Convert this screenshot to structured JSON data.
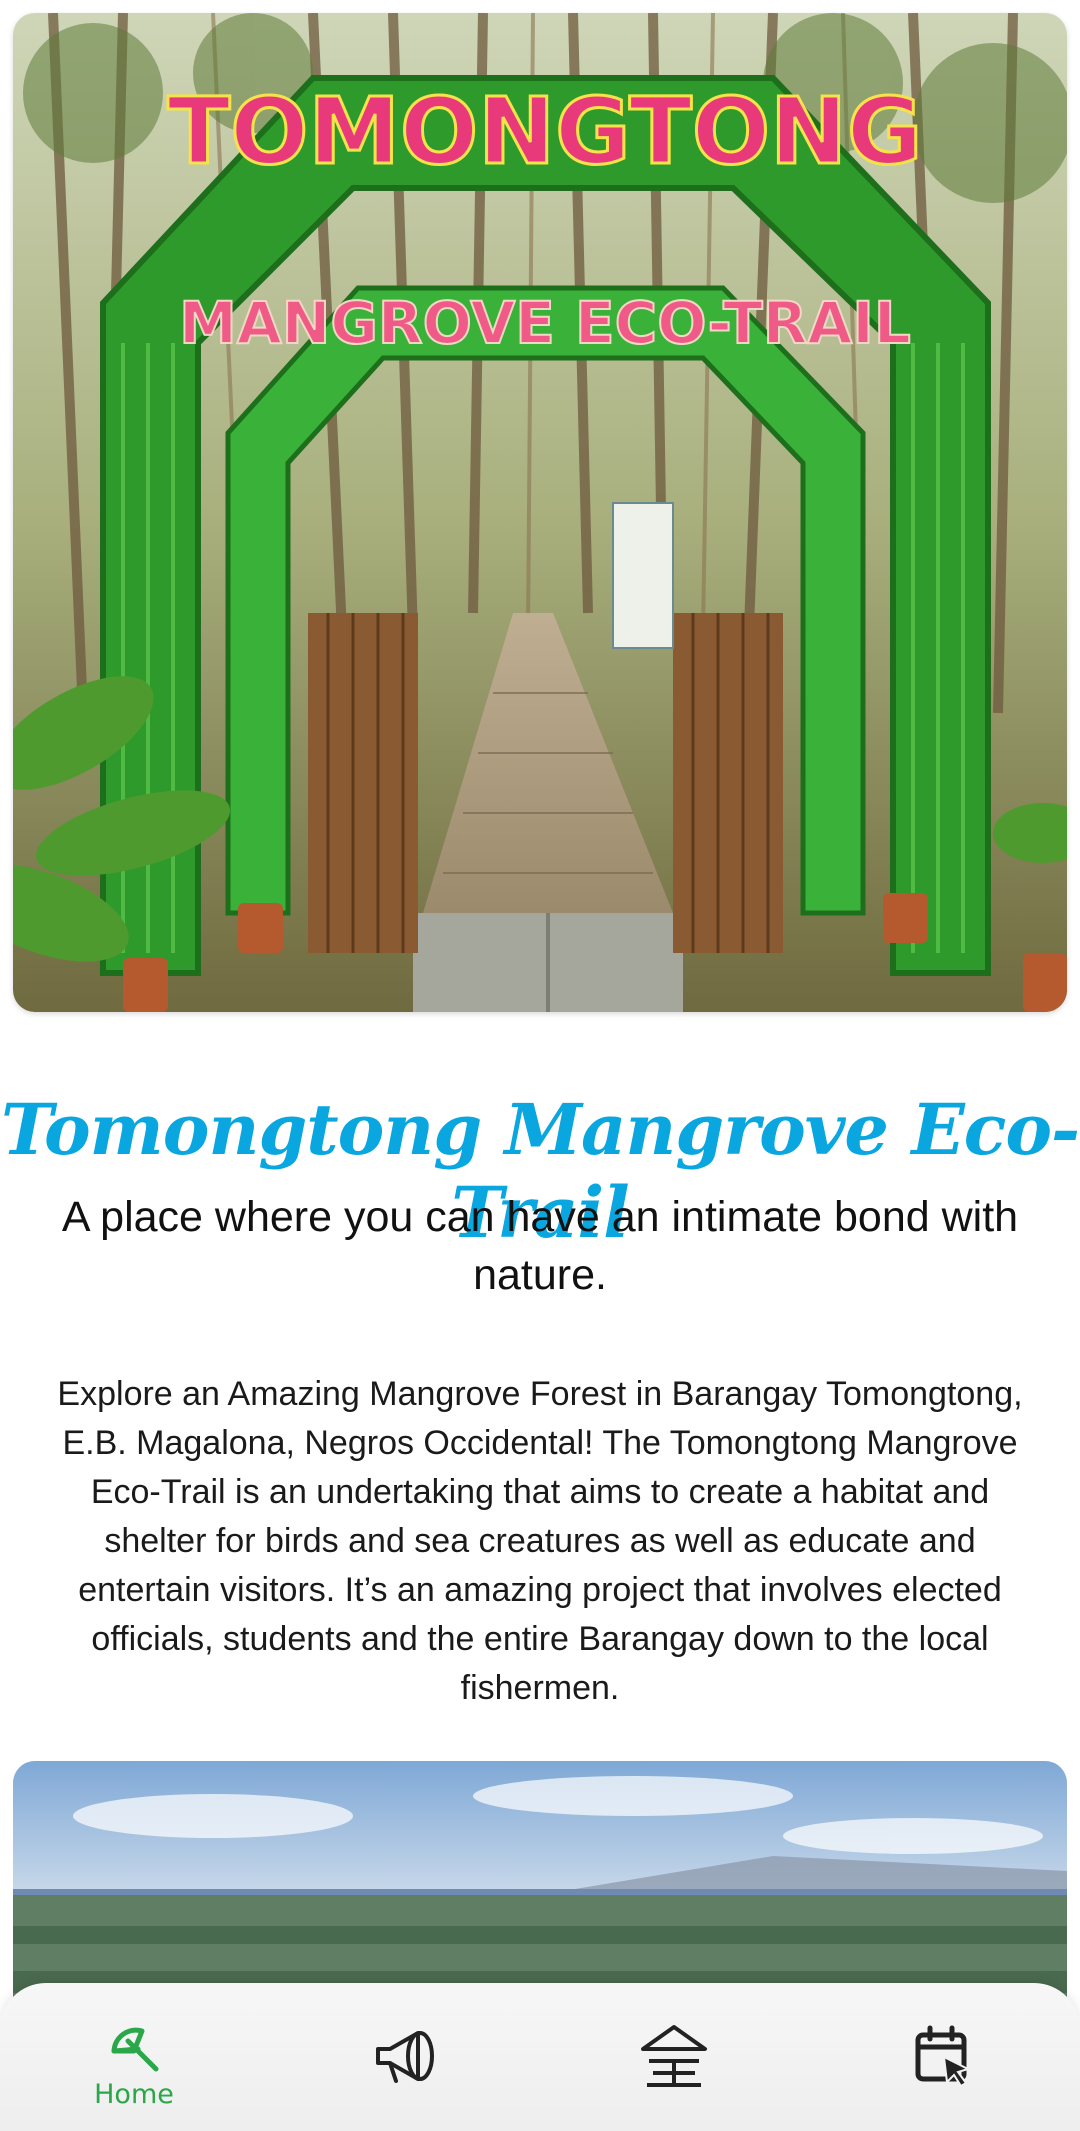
{
  "hero": {
    "sign_top": "TOMONGTONG",
    "sign_bottom": "MANGROVE ECO-TRAIL"
  },
  "content": {
    "title": "Tomongtong Mangrove Eco-Trail",
    "subtitle": "A place where you can have an intimate bond with nature.",
    "description": "Explore an Amazing Mangrove Forest in Barangay Tomongtong, E.B. Magalona, Negros Occidental! The Tomongtong Mangrove Eco-Trail is an undertaking that aims to create a habitat and shelter for birds and sea creatures as well as educate and entertain visitors. It’s an amazing project that involves elected officials, students and the entire Barangay down to the local fishermen."
  },
  "nav": {
    "items": [
      {
        "icon": "umbrella-icon",
        "label": "Home",
        "active": true
      },
      {
        "icon": "megaphone-icon",
        "active": false
      },
      {
        "icon": "hut-icon",
        "active": false
      },
      {
        "icon": "calendar-cursor-icon",
        "active": false
      }
    ]
  },
  "colors": {
    "title": "#0aa6df",
    "active_nav": "#2aa748",
    "inactive_nav": "#222222"
  }
}
